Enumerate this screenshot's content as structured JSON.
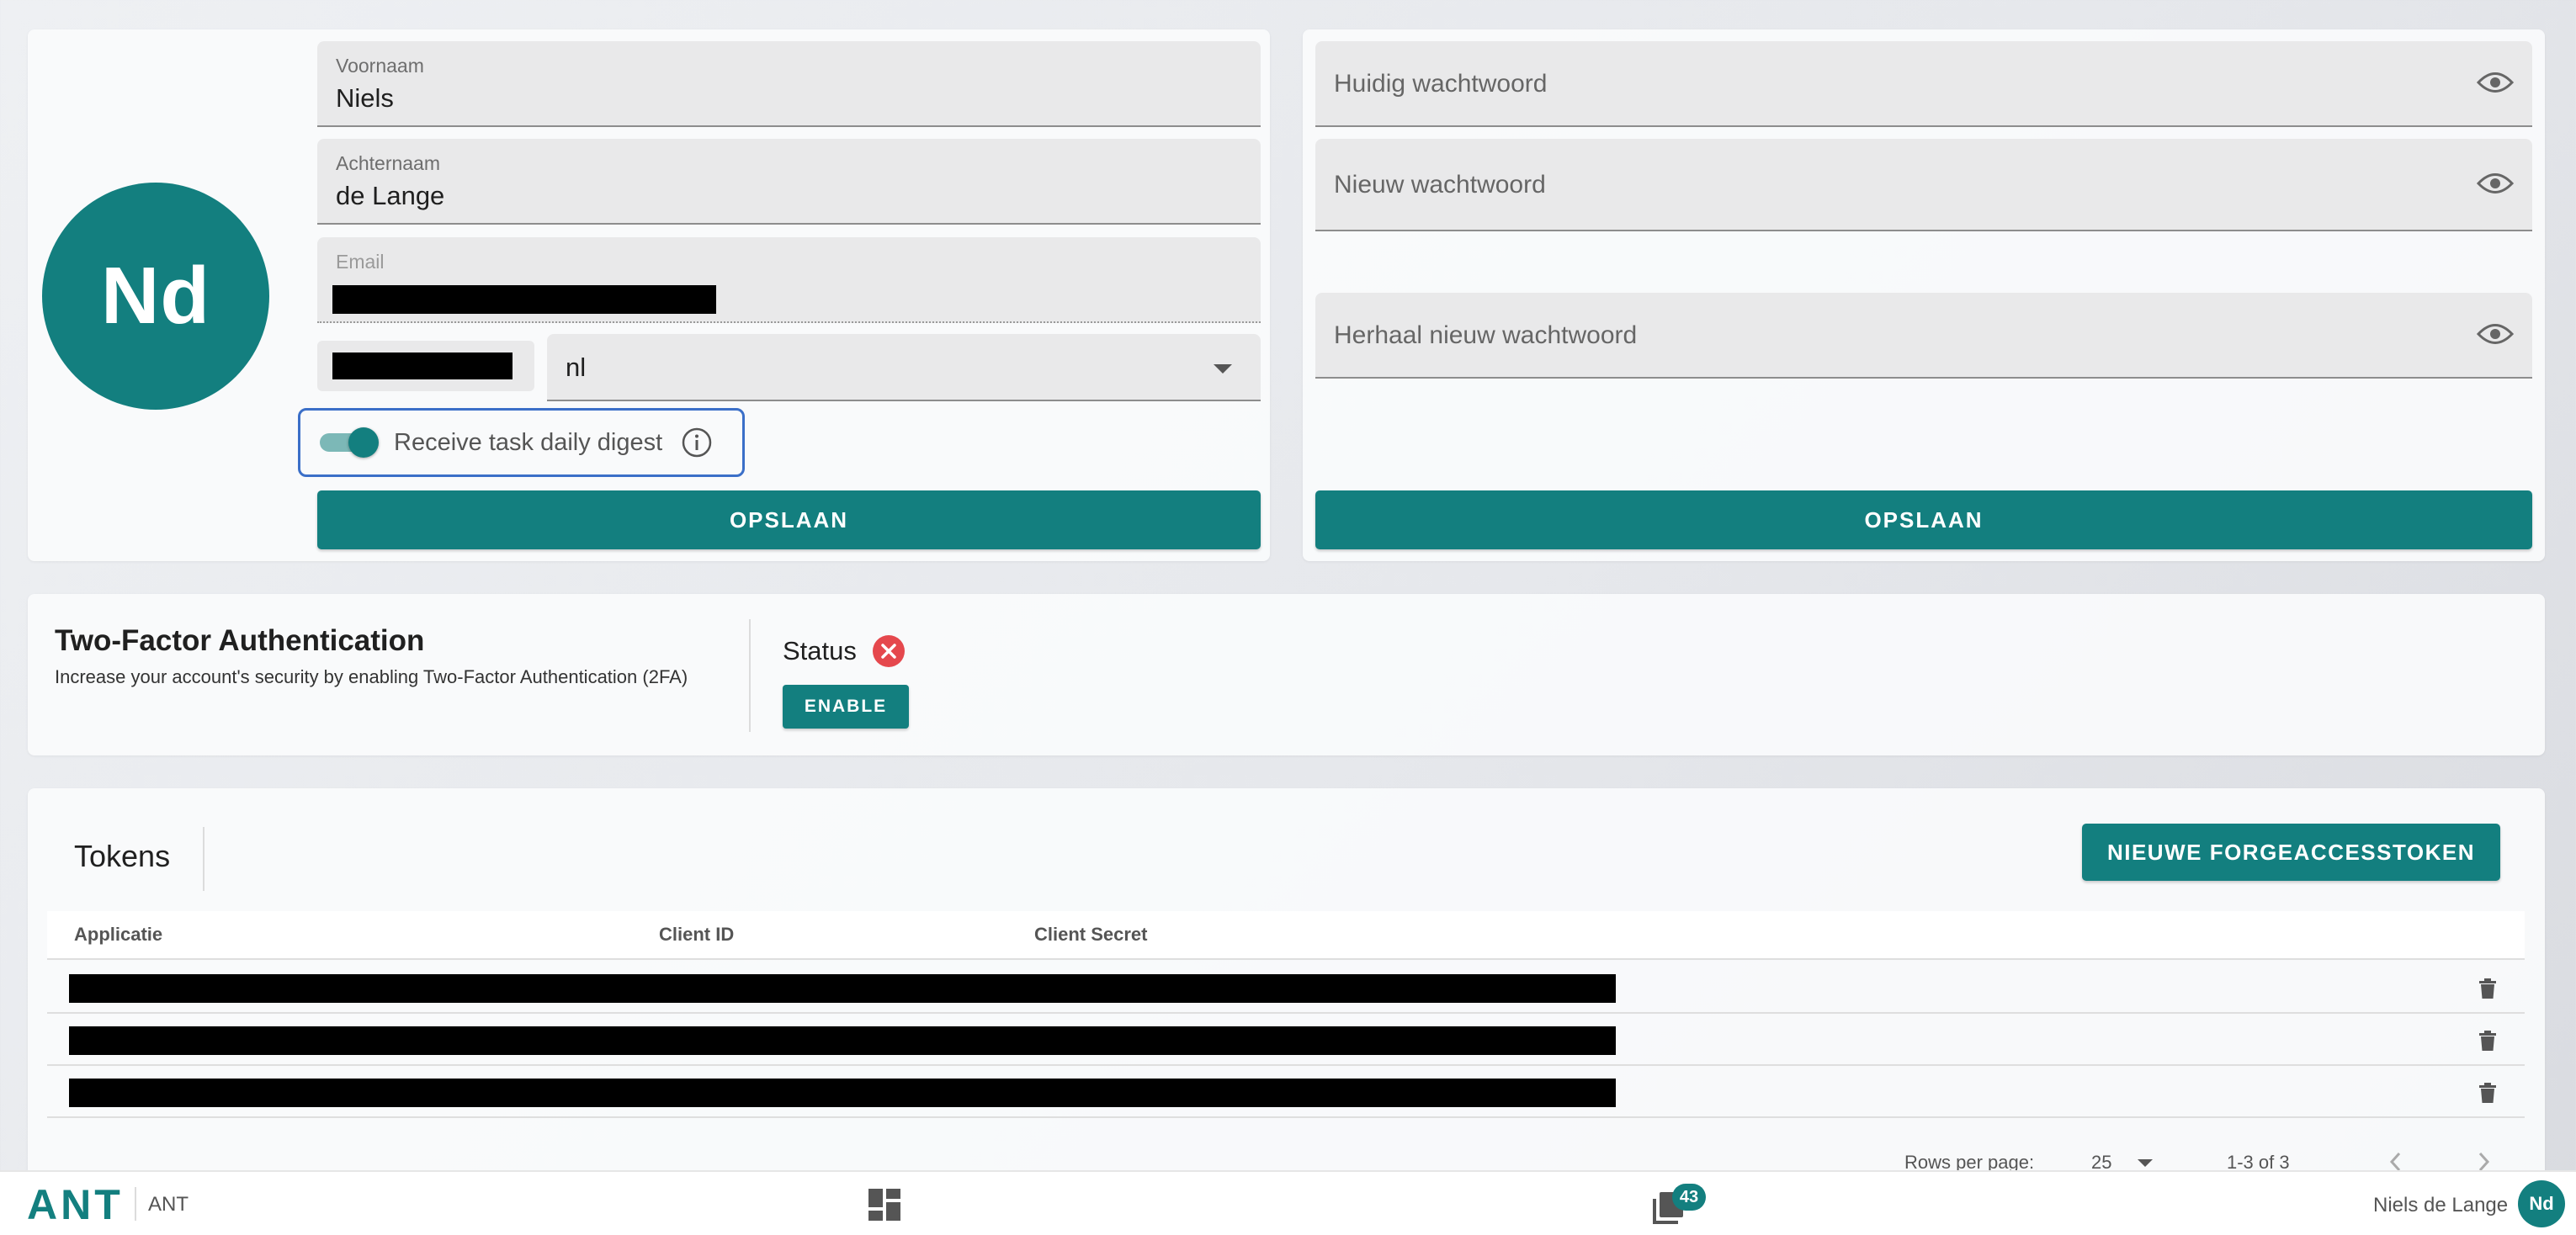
{
  "profile": {
    "avatar_initials": "Nd",
    "first_name": {
      "label": "Voornaam",
      "value": "Niels"
    },
    "last_name": {
      "label": "Achternaam",
      "value": "de Lange"
    },
    "email": {
      "label": "Email"
    },
    "language_select": {
      "value": "nl"
    },
    "digest_toggle": {
      "label": "Receive task daily digest",
      "checked": true
    },
    "save_label": "OPSLAAN"
  },
  "password": {
    "current_placeholder": "Huidig wachtwoord",
    "new_placeholder": "Nieuw wachtwoord",
    "repeat_placeholder": "Herhaal nieuw wachtwoord",
    "save_label": "OPSLAAN"
  },
  "two_factor": {
    "title": "Two-Factor Authentication",
    "description": "Increase your account's security by enabling Two-Factor Authentication (2FA)",
    "status_label": "Status",
    "enable_label": "ENABLE"
  },
  "tokens": {
    "title": "Tokens",
    "new_button_label": "NIEUWE FORGEACCESSTOKEN",
    "columns": [
      "Applicatie",
      "Client ID",
      "Client Secret"
    ],
    "rows_per_page_label": "Rows per page:",
    "rows_per_page_value": "25",
    "range_label": "1-3 of 3"
  },
  "bottom_bar": {
    "logo": "ANT",
    "app_name": "ANT",
    "notification_count": "43",
    "user_name": "Niels de Lange",
    "user_initials": "Nd"
  },
  "colors": {
    "primary": "#137f7f",
    "focus_outline": "#3b6fc8",
    "error": "#e5484d"
  }
}
